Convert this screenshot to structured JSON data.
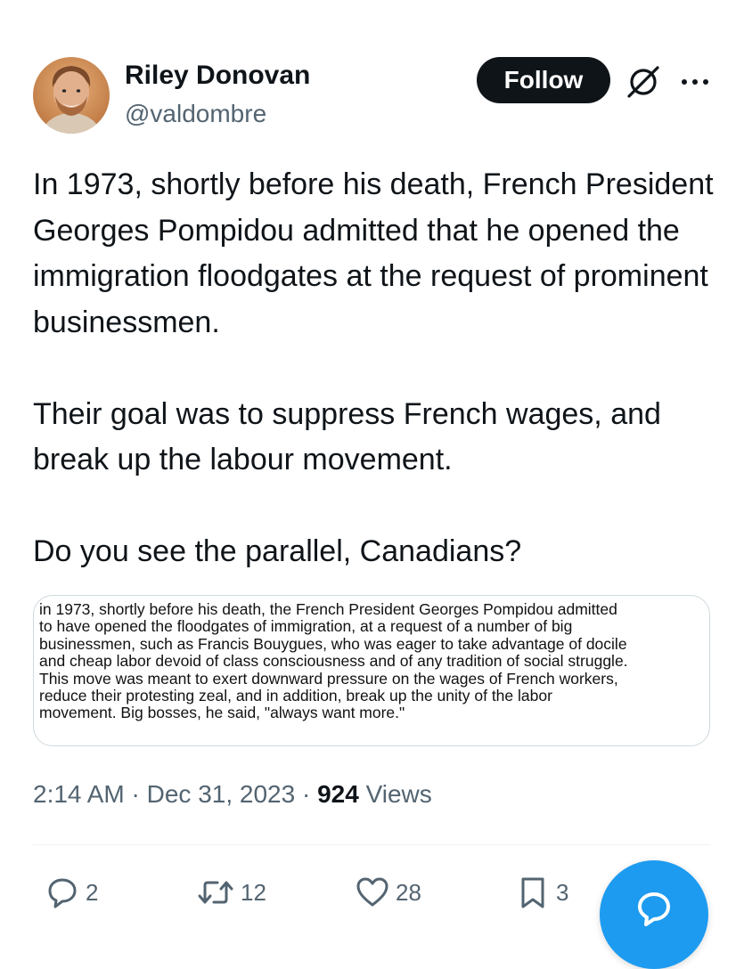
{
  "author": {
    "display_name": "Riley Donovan",
    "handle": "@valdombre"
  },
  "header": {
    "follow_label": "Follow",
    "grok_icon": "grok-icon",
    "more_icon": "more-icon"
  },
  "tweet": {
    "paragraphs": [
      "In 1973, shortly before his death, French President Georges Pompidou admitted that he opened the immigration floodgates at the request of prominent businessmen.",
      "Their goal was to suppress French wages, and break up the labour movement.",
      "Do you see the parallel, Canadians?"
    ],
    "image_text": "in 1973, shortly before his death, the French President Georges Pompidou admitted\nto have opened the floodgates of immigration, at a request of a number of big\nbusinessmen, such as Francis Bouygues, who was eager to take advantage of docile\nand cheap labor devoid of class consciousness and of any tradition of social struggle.\nThis move was meant to exert downward pressure on the wages of French workers,\nreduce their protesting zeal, and in addition, break up the unity of the labor\nmovement. Big bosses, he said, \"always want more.\""
  },
  "meta": {
    "time": "2:14 AM",
    "separator": "·",
    "date": "Dec 31, 2023",
    "views_count": "924",
    "views_label": "Views"
  },
  "actions": {
    "replies": "2",
    "retweets": "12",
    "likes": "28",
    "bookmarks": "3"
  },
  "colors": {
    "follow_bg": "#0f1419",
    "secondary_text": "#536471",
    "fab_blue": "#1d9bf0"
  }
}
